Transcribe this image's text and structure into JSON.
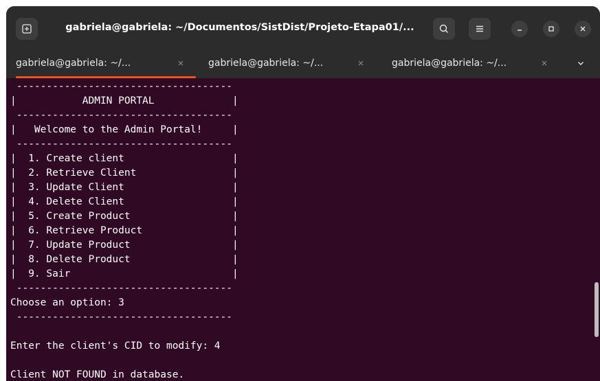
{
  "window": {
    "title": "gabriela@gabriela: ~/Documentos/SistDist/Projeto-Etapa01/...",
    "icons": {
      "new_tab": "new-tab-icon",
      "search": "search-icon",
      "menu": "hamburger-menu-icon",
      "minimize": "minimize-icon",
      "maximize": "maximize-icon",
      "close": "close-icon"
    }
  },
  "tabs": [
    {
      "label": "gabriela@gabriela: ~/...",
      "active": true
    },
    {
      "label": "gabriela@gabriela: ~/...",
      "active": false
    },
    {
      "label": "gabriela@gabriela: ~/...",
      "active": false
    }
  ],
  "terminal": {
    "lines": [
      " ------------------------------------",
      "|           ADMIN PORTAL             |",
      " ------------------------------------",
      "|   Welcome to the Admin Portal!     |",
      " ------------------------------------",
      "|  1. Create client                  |",
      "|  2. Retrieve Client                |",
      "|  3. Update Client                  |",
      "|  4. Delete Client                  |",
      "|  5. Create Product                 |",
      "|  6. Retrieve Product               |",
      "|  7. Update Product                 |",
      "|  8. Delete Product                 |",
      "|  9. Sair                           |",
      " ------------------------------------",
      "Choose an option: 3",
      " ------------------------------------",
      "",
      "Enter the client's CID to modify: 4",
      "",
      "Client NOT FOUND in database."
    ]
  },
  "colors": {
    "titlebar": "#2c2c2c",
    "terminal_bg": "#300a24",
    "accent": "#e95420",
    "text": "#ffffff"
  }
}
